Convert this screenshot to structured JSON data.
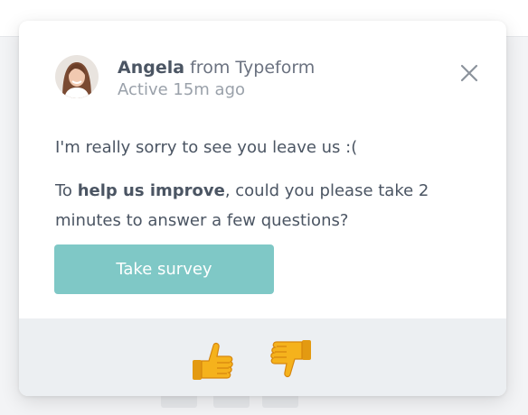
{
  "message": {
    "sender_name": "Angela",
    "sender_org": "from Typeform",
    "status": "Active 15m ago",
    "line1": "I'm really sorry to see you leave us :(",
    "line2_prefix": "To",
    "line2_bold": "help us improve",
    "line2_suffix": ", could you please take 2 minutes to answer a few questions?",
    "survey_button_label": "Take survey"
  },
  "icons": {
    "close": "close-icon",
    "thumbs_up": "thumbs-up-icon",
    "thumbs_down": "thumbs-down-icon",
    "avatar": "avatar"
  },
  "colors": {
    "button": "#7fc8c6",
    "footer": "#eceff2",
    "thumb": "#f5b21c",
    "text": "#4b5563",
    "muted": "#9aa1aa"
  }
}
